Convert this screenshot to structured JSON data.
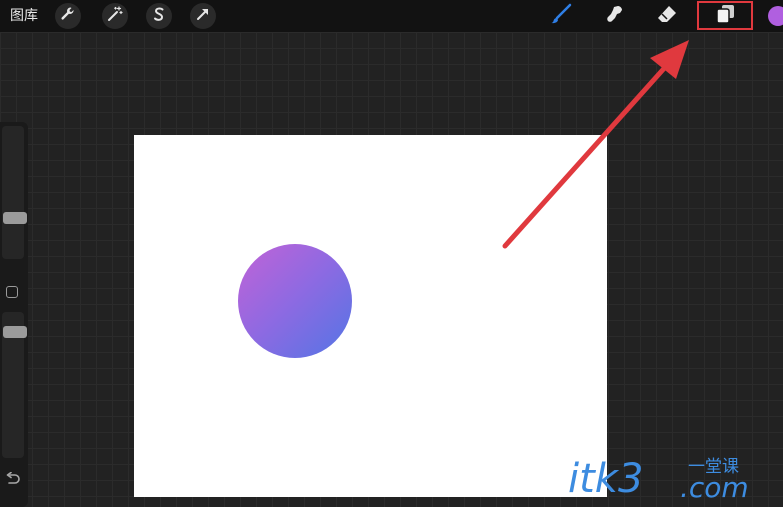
{
  "topbar": {
    "gallery_label": "图库",
    "actions_icon": "wrench-icon",
    "adjustments_icon": "magic-wand-icon",
    "selection_icon": "selection-s-icon",
    "transform_icon": "arrow-cursor-icon",
    "brush_icon": "brush-icon",
    "smudge_icon": "smudge-icon",
    "eraser_icon": "eraser-icon",
    "layers_icon": "layers-icon",
    "color": "#b05fe0",
    "brush_color": "#2f7fe6"
  },
  "sidebar": {
    "size_slider_icon": "slider-handle",
    "modify_icon": "square-icon",
    "opacity_slider_icon": "slider-handle",
    "undo_icon": "undo-icon"
  },
  "annotation": {
    "highlight_color": "#e0393e",
    "arrow_color": "#e0393e"
  },
  "watermark": {
    "main": "itk3",
    "cn": "一堂课",
    "com": ".com"
  }
}
